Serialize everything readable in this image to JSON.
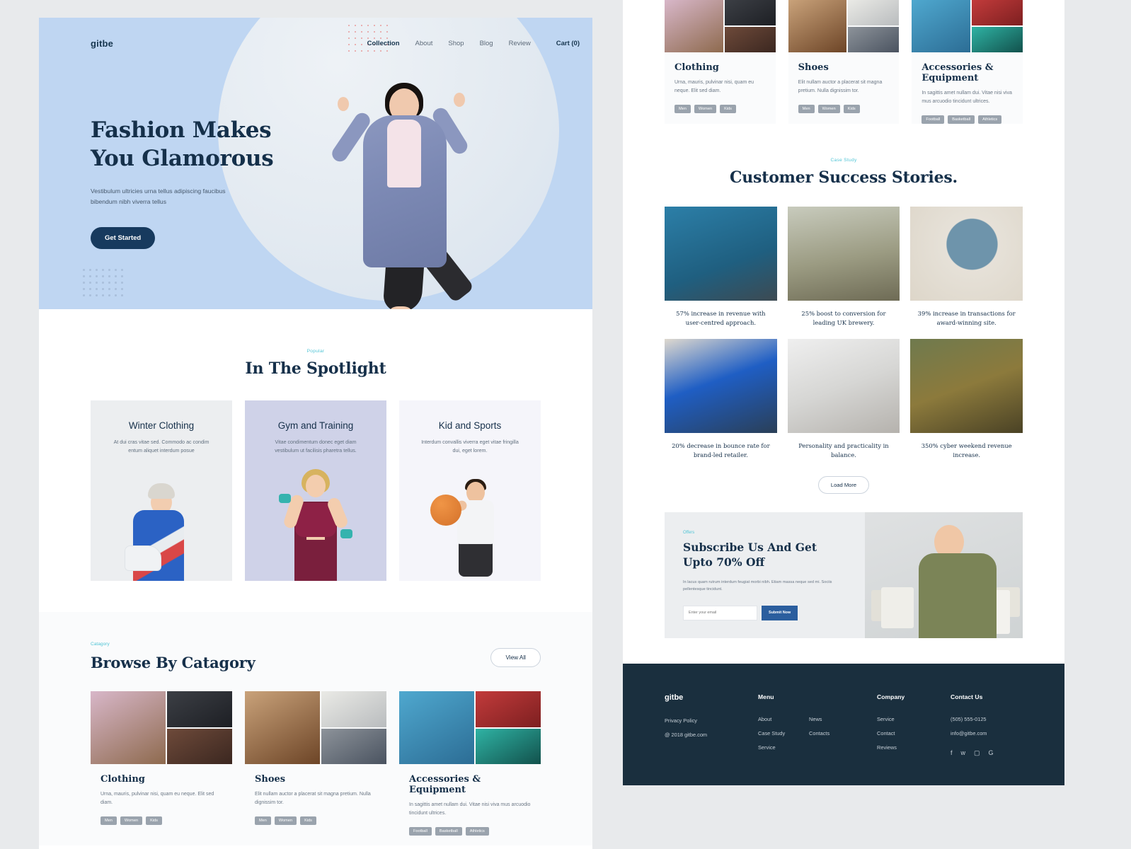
{
  "nav": {
    "brand": "gitbe",
    "links": [
      {
        "label": "Collection",
        "active": true
      },
      {
        "label": "About",
        "active": false
      },
      {
        "label": "Shop",
        "active": false
      },
      {
        "label": "Blog",
        "active": false
      },
      {
        "label": "Review",
        "active": false
      }
    ],
    "cart": "Cart (0)"
  },
  "hero": {
    "title_line1": "Fashion Makes",
    "title_line2": "You Glamorous",
    "sub_line1": "Vestibulum ultricies urna tellus adipiscing faucibus",
    "sub_line2": "bibendum nibh viverra tellus",
    "cta": "Get Started"
  },
  "spotlight": {
    "eyebrow": "Popular",
    "title": "In The Spotlight",
    "cards": [
      {
        "title": "Winter Clothing",
        "desc": "At dui cras vitae sed. Commodo ac condim entum aliquet interdum posue"
      },
      {
        "title": "Gym and Training",
        "desc": "Vitae condimentum donec eget diam vestibulum ut facilisis pharetra tellus."
      },
      {
        "title": "Kid and Sports",
        "desc": "Interdum convallis viverra eget vitae fringilla dui, eget lorem."
      }
    ]
  },
  "category": {
    "eyebrow": "Catagory",
    "title": "Browse By Catagory",
    "view_all": "View All",
    "items": [
      {
        "name": "Clothing",
        "desc": "Urna, mauris, pulvinar nisi, quam eu neque. Elit sed diam.",
        "tags": [
          "Men",
          "Women",
          "Kids"
        ]
      },
      {
        "name": "Shoes",
        "desc": "Elit nullam auctor a placerat sit magna pretium. Nulla dignissim tor.",
        "tags": [
          "Men",
          "Women",
          "Kids"
        ]
      },
      {
        "name": "Accessories & Equipment",
        "desc": "In sagittis amet nullam dui. Vitae nisi viva mus arcuodio tincidunt ultrices.",
        "tags": [
          "Football",
          "Basketball",
          "Athletics"
        ]
      }
    ]
  },
  "success": {
    "eyebrow": "Case Study",
    "title": "Customer Success Stories.",
    "stories": [
      {
        "caption": "57% increase in revenue with user-centred approach."
      },
      {
        "caption": "25% boost to conversion for leading UK brewery."
      },
      {
        "caption": "39% increase in transactions for award-winning site."
      },
      {
        "caption": "20% decrease in bounce rate for brand-led retailer."
      },
      {
        "caption": "Personality and practicality in balance."
      },
      {
        "caption": "350% cyber weekend revenue increase."
      }
    ],
    "load_more": "Load More"
  },
  "offer": {
    "eyebrow": "Offers",
    "title_line1": "Subscribe Us And Get",
    "title_line2": "Upto 70% Off",
    "paragraph": "In lacus quam rutrum interdum feugiat morbi nibh. Etiam massa neque sed mi. Sociis pellentesque tincidunt.",
    "input_placeholder": "Enter your email",
    "submit": "Submit Now"
  },
  "footer": {
    "brand": "gitbe",
    "brand_links": [
      "Privacy Policy",
      "@ 2018 gitbe.com"
    ],
    "menu_head": "Menu",
    "menu_col1": [
      "About",
      "Case Study",
      "Service"
    ],
    "menu_col2": [
      "News",
      "Contacts"
    ],
    "company_head": "Company",
    "company_links": [
      "Service",
      "Contact",
      "Reviews"
    ],
    "contact_head": "Contact Us",
    "phone": "(505) 555-0125",
    "email": "info@gitbe.com",
    "socials": [
      "facebook-icon",
      "twitter-icon",
      "instagram-icon",
      "google-plus-icon"
    ]
  },
  "colors": {
    "hero_bg": "#bfd6f2",
    "dark_navy": "#16304a",
    "accent_cyan": "#52c5d6",
    "footer_bg": "#1a2f3e",
    "button_blue": "#2b5e9e"
  }
}
